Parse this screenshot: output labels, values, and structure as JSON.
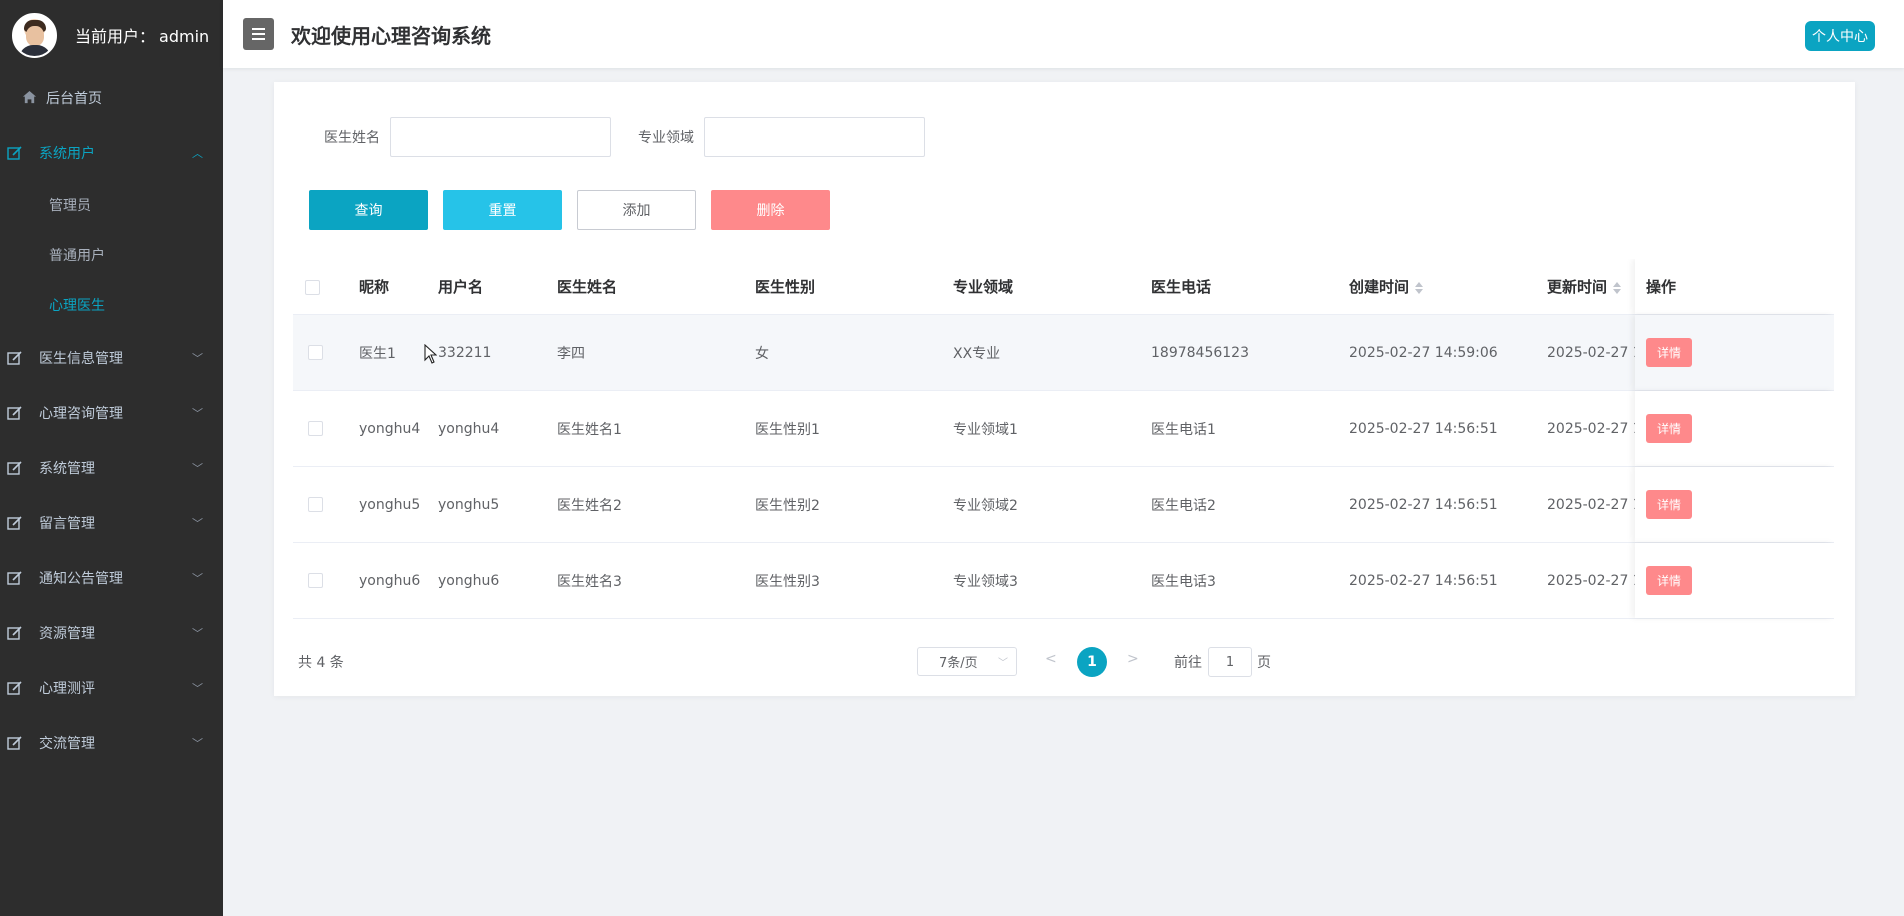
{
  "sidebar": {
    "user_prefix": "当前用户：",
    "user_name": "admin",
    "home": "后台首页",
    "groups": [
      {
        "label": "系统用户",
        "icon": "edit-icon",
        "expanded": true
      },
      {
        "label": "医生信息管理",
        "icon": "edit-icon"
      },
      {
        "label": "心理咨询管理",
        "icon": "edit-icon"
      },
      {
        "label": "系统管理",
        "icon": "edit-icon"
      },
      {
        "label": "留言管理",
        "icon": "edit-icon"
      },
      {
        "label": "通知公告管理",
        "icon": "edit-icon"
      },
      {
        "label": "资源管理",
        "icon": "edit-icon"
      },
      {
        "label": "心理测评",
        "icon": "edit-icon"
      },
      {
        "label": "交流管理",
        "icon": "edit-icon"
      }
    ],
    "sub_items": [
      "管理员",
      "普通用户",
      "心理医生"
    ],
    "active_sub": "心理医生"
  },
  "header": {
    "title": "欢迎使用心理咨询系统",
    "profile_button": "个人中心"
  },
  "search": {
    "doctor_name_label": "医生姓名",
    "doctor_name_value": "",
    "field_label": "专业领域",
    "field_value": ""
  },
  "buttons": {
    "query": "查询",
    "reset": "重置",
    "add": "添加",
    "delete": "删除"
  },
  "table": {
    "headers": {
      "nickname": "昵称",
      "username": "用户名",
      "doctor_name": "医生姓名",
      "doctor_sex": "医生性别",
      "field": "专业领域",
      "phone": "医生电话",
      "create_time": "创建时间",
      "update_time": "更新时间",
      "actions": "操作"
    },
    "rows": [
      {
        "nickname": "医生1",
        "username": "332211",
        "doctor_name": "李四",
        "doctor_sex": "女",
        "field": "XX专业",
        "phone": "18978456123",
        "create_time": "2025-02-27 14:59:06",
        "update_time": "2025-02-27 1",
        "action": "详情"
      },
      {
        "nickname": "yonghu4",
        "username": "yonghu4",
        "doctor_name": "医生姓名1",
        "doctor_sex": "医生性别1",
        "field": "专业领域1",
        "phone": "医生电话1",
        "create_time": "2025-02-27 14:56:51",
        "update_time": "2025-02-27 1",
        "action": "详情"
      },
      {
        "nickname": "yonghu5",
        "username": "yonghu5",
        "doctor_name": "医生姓名2",
        "doctor_sex": "医生性别2",
        "field": "专业领域2",
        "phone": "医生电话2",
        "create_time": "2025-02-27 14:56:51",
        "update_time": "2025-02-27 1",
        "action": "详情"
      },
      {
        "nickname": "yonghu6",
        "username": "yonghu6",
        "doctor_name": "医生姓名3",
        "doctor_sex": "医生性别3",
        "field": "专业领域3",
        "phone": "医生电话3",
        "create_time": "2025-02-27 14:56:51",
        "update_time": "2025-02-27 1",
        "action": "详情"
      }
    ]
  },
  "pagination": {
    "total": "共 4 条",
    "page_size": "7条/页",
    "current_page": "1",
    "goto_prefix": "前往",
    "goto_value": "1",
    "goto_suffix": "页"
  },
  "colors": {
    "accent": "#0ba4c2",
    "reset": "#26c3e8",
    "danger": "#fe898b",
    "sidebar_bg": "#2d2d2d"
  }
}
